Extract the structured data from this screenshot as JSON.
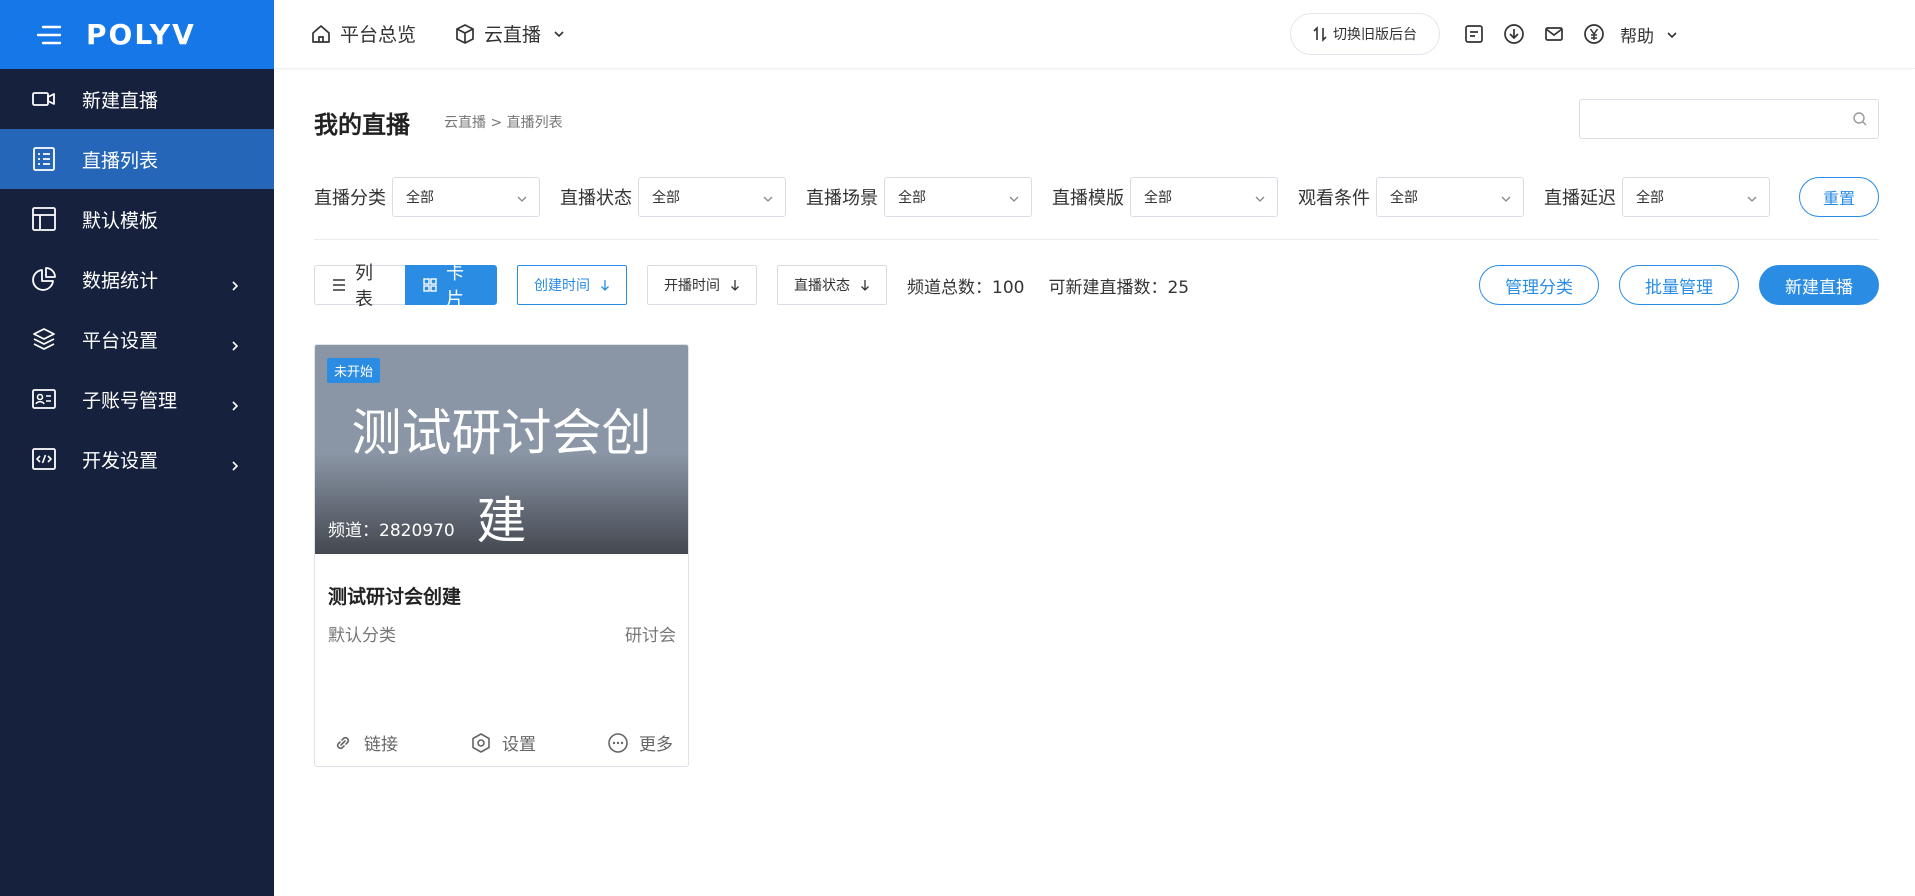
{
  "brand": {
    "logo_text": "POLYV"
  },
  "sidebar": {
    "items": [
      {
        "label": "新建直播",
        "icon": "video-camera-icon"
      },
      {
        "label": "直播列表",
        "icon": "list-icon",
        "active": true
      },
      {
        "label": "默认模板",
        "icon": "template-layout-icon"
      },
      {
        "label": "数据统计",
        "icon": "pie-chart-icon",
        "has_submenu": true
      },
      {
        "label": "平台设置",
        "icon": "layers-icon",
        "has_submenu": true
      },
      {
        "label": "子账号管理",
        "icon": "id-card-icon",
        "has_submenu": true
      },
      {
        "label": "开发设置",
        "icon": "code-icon",
        "has_submenu": true
      }
    ]
  },
  "header": {
    "home_label": "平台总览",
    "cloud_live_label": "云直播",
    "switch_label": "切换旧版后台",
    "help_label": "帮助"
  },
  "main": {
    "page_title": "我的直播",
    "breadcrumb": "云直播 >  直播列表",
    "search": {
      "value": "",
      "placeholder": ""
    }
  },
  "filters": [
    {
      "label": "直播分类",
      "value": "全部"
    },
    {
      "label": "直播状态",
      "value": "全部"
    },
    {
      "label": "直播场景",
      "value": "全部"
    },
    {
      "label": "直播模版",
      "value": "全部"
    },
    {
      "label": "观看条件",
      "value": "全部"
    },
    {
      "label": "直播延迟",
      "value": "全部"
    }
  ],
  "reset_label": "重置",
  "toolbar": {
    "list_view_label": "列表",
    "card_view_label": "卡片",
    "sort_create_label": "创建时间",
    "sort_start_label": "开播时间",
    "sort_status_label": "直播状态",
    "channel_total": "频道总数：100",
    "creatable": "可新建直播数：25",
    "manage_category_label": "管理分类",
    "batch_manage_label": "批量管理",
    "new_live_label": "新建直播"
  },
  "cards": [
    {
      "status_badge": "未开始",
      "cover_title": "测试研讨会创建",
      "channel": "频道：2820970",
      "title": "测试研讨会创建",
      "category": "默认分类",
      "scene": "研讨会",
      "actions": {
        "link": "链接",
        "settings": "设置",
        "more": "更多"
      }
    }
  ],
  "colors": {
    "sidebar_bg": "#16213e",
    "brand_bg": "#1677e8",
    "active_item": "#2566b8",
    "primary": "#2a8ce3"
  }
}
